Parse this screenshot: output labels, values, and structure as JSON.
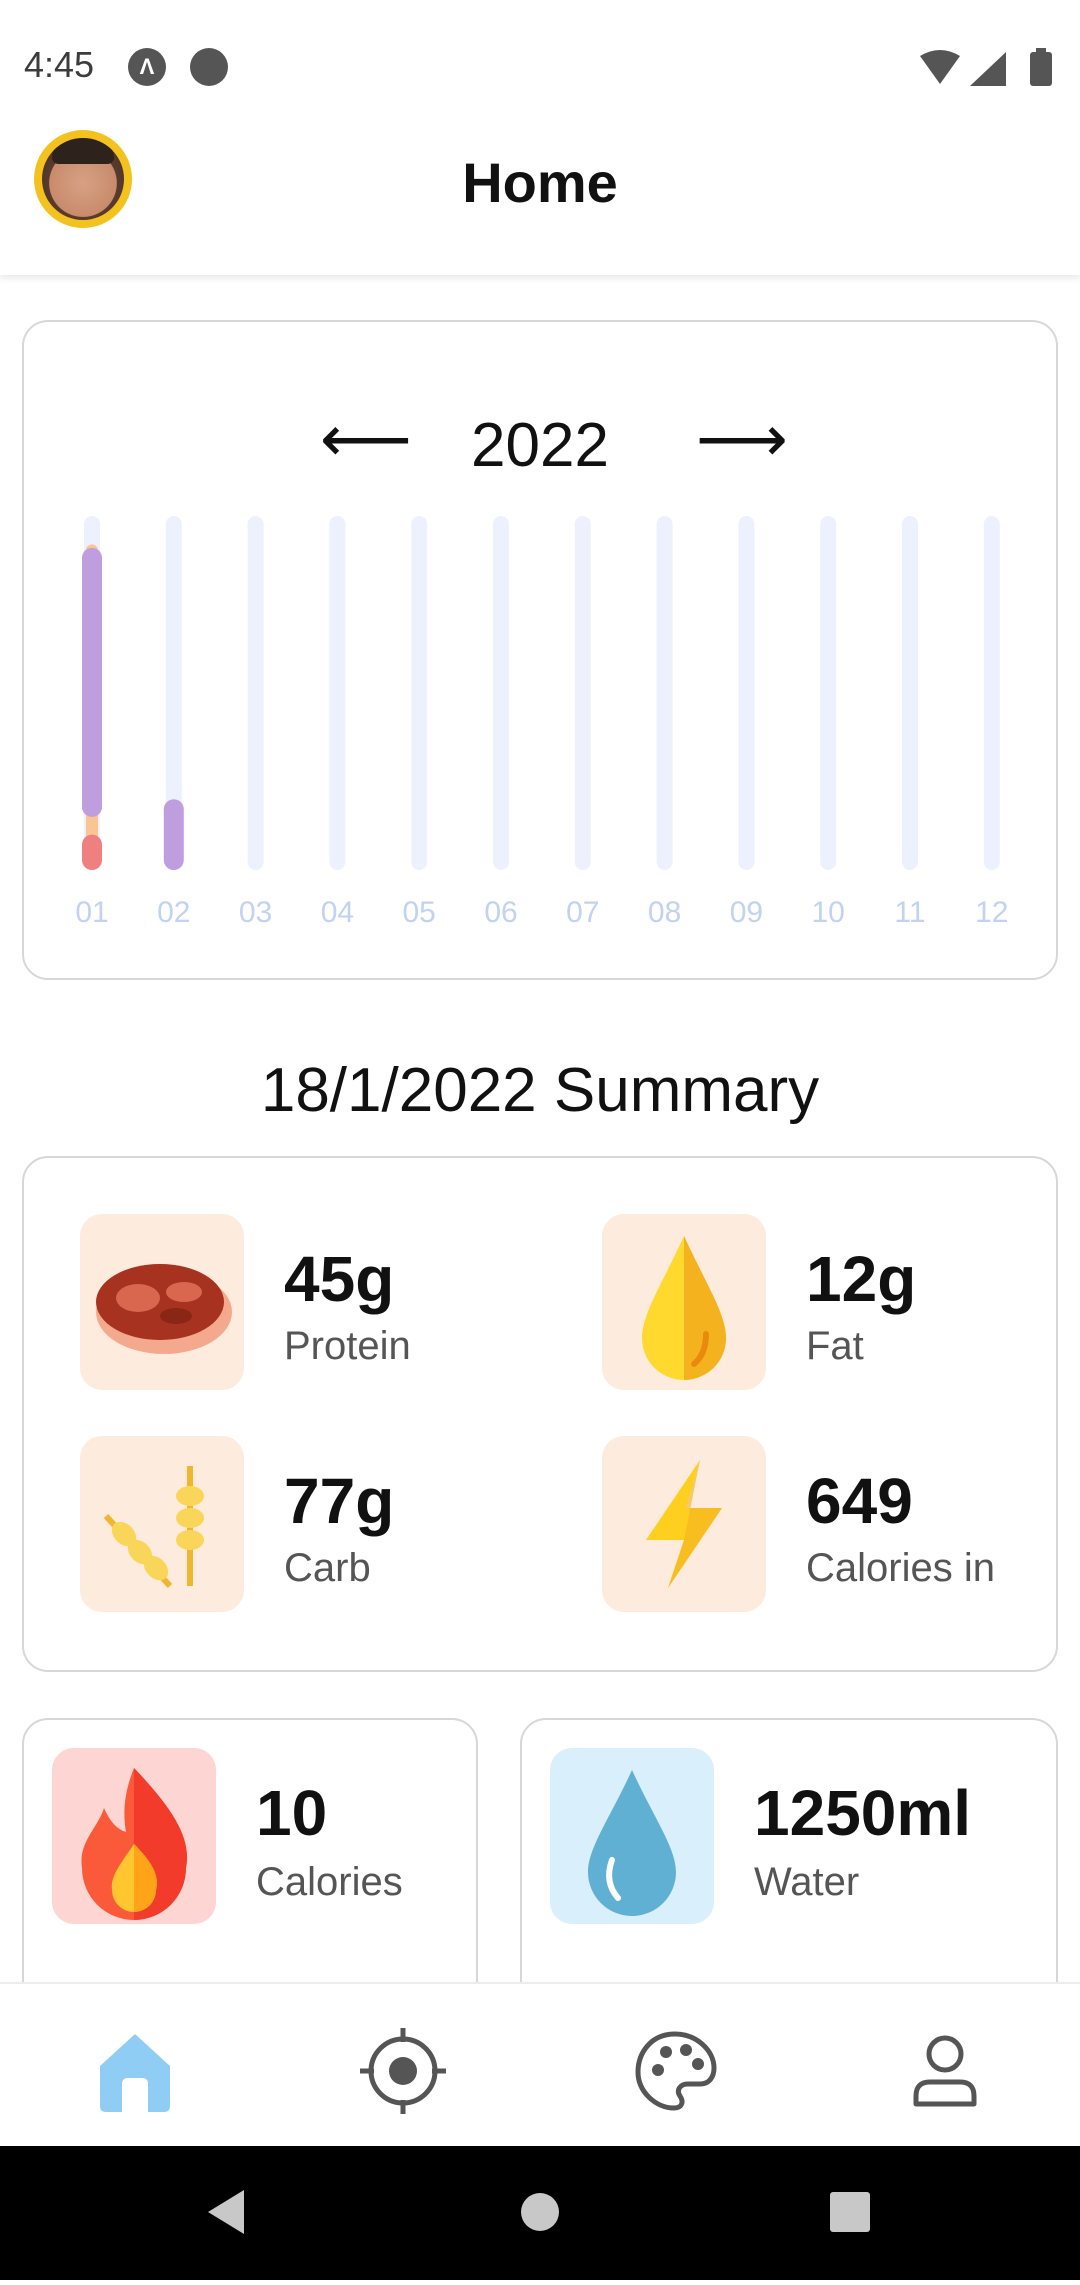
{
  "status_bar": {
    "time": "4:45",
    "icons": [
      "app-icon-a",
      "app-icon-b",
      "wifi-icon",
      "signal-icon",
      "battery-icon"
    ]
  },
  "app_bar": {
    "title": "Home",
    "avatar": "user-avatar"
  },
  "chart": {
    "year": "2022",
    "prev_icon": "arrow-left-icon",
    "next_icon": "arrow-right-icon"
  },
  "chart_data": {
    "type": "bar",
    "categories": [
      "01",
      "02",
      "03",
      "04",
      "05",
      "06",
      "07",
      "08",
      "09",
      "10",
      "11",
      "12"
    ],
    "series": [
      {
        "color": "#f08080",
        "values": [
          0.1,
          0,
          0,
          0,
          0,
          0,
          0,
          0,
          0,
          0,
          0,
          0
        ]
      },
      {
        "color": "#fac590",
        "values": [
          0.92,
          0,
          0,
          0,
          0,
          0,
          0,
          0,
          0,
          0,
          0,
          0
        ]
      },
      {
        "color": "#bf9ee0",
        "values": [
          0.76,
          0.2,
          0,
          0,
          0,
          0,
          0,
          0,
          0,
          0,
          0,
          0
        ]
      }
    ],
    "track_color": "#edf1fd",
    "label_color": "#c2d2f2"
  },
  "summary": {
    "title": "18/1/2022 Summary",
    "items": [
      {
        "value": "45g",
        "label": "Protein",
        "icon": "meat-icon"
      },
      {
        "value": "12g",
        "label": "Fat",
        "icon": "drop-icon"
      },
      {
        "value": "77g",
        "label": "Carb",
        "icon": "wheat-icon"
      },
      {
        "value": "649",
        "label": "Calories in",
        "icon": "lightning-icon"
      }
    ]
  },
  "stats": {
    "calories": {
      "value": "10",
      "label": "Calories",
      "icon": "fire-icon",
      "bg": "#fdd5d3"
    },
    "water": {
      "value": "1250ml",
      "label": "Water",
      "icon": "water-drop-icon",
      "bg": "#d9effc"
    }
  },
  "bottom_nav": {
    "items": [
      "home-icon",
      "target-icon",
      "palette-icon",
      "profile-icon"
    ],
    "active_color": "#90cdf4"
  }
}
